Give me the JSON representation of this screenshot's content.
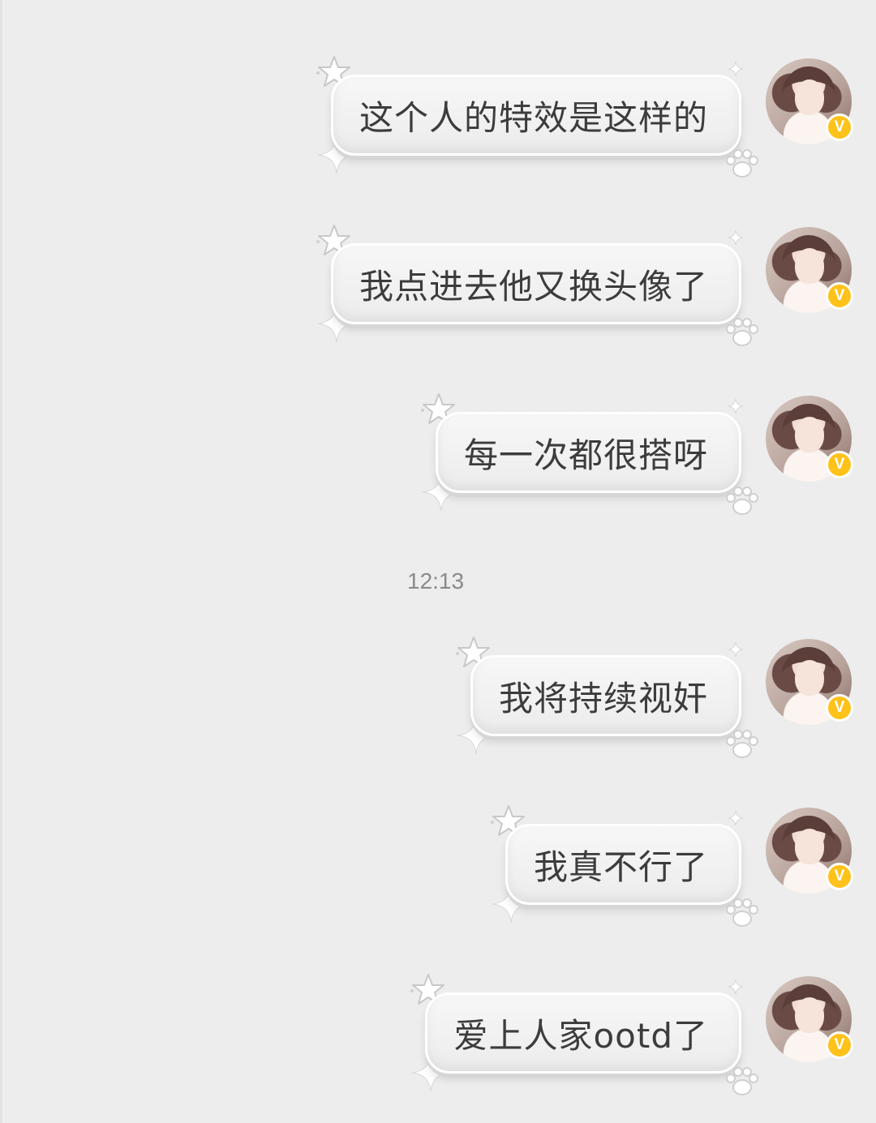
{
  "conversation": {
    "messages": [
      {
        "text": "这个人的特效是这样的",
        "sender": "self"
      },
      {
        "text": "我点进去他又换头像了",
        "sender": "self"
      },
      {
        "text": "每一次都很搭呀",
        "sender": "self"
      },
      {
        "text": "我将持续视奸",
        "sender": "self"
      },
      {
        "text": "我真不行了",
        "sender": "self"
      },
      {
        "text": "爱上人家ootd了",
        "sender": "self"
      }
    ],
    "timestamp": "12:13",
    "vip_badge_label": "V"
  },
  "colors": {
    "background": "#ededed",
    "bubble": "#f2f2f2",
    "text": "#3c3c3c",
    "timestamp": "#8a8a8a",
    "vip_badge": "#ffc21a"
  },
  "icons": [
    "star-outline-icon",
    "sparkle-icon",
    "paw-icon",
    "vip-badge-icon"
  ]
}
